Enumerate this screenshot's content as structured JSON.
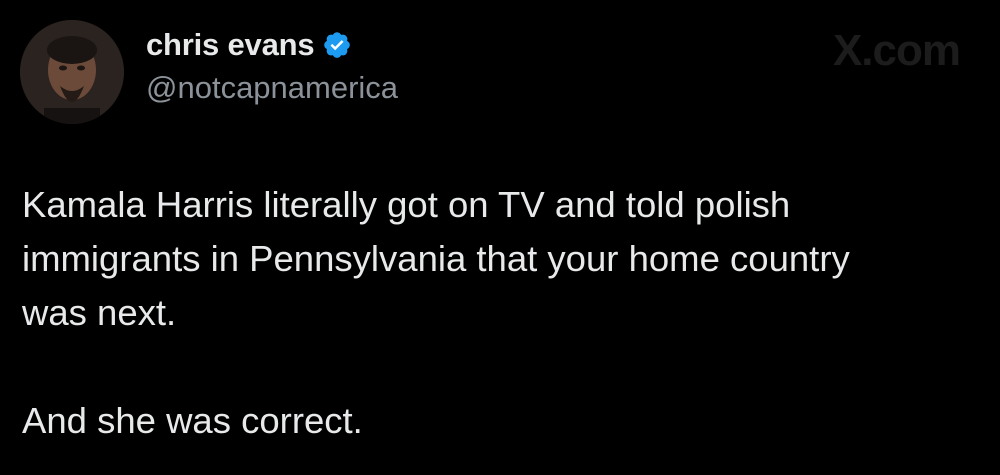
{
  "tweet": {
    "author": {
      "display_name": "chris evans",
      "handle": "@notcapnamerica",
      "verified": true,
      "avatar": "profile-photo"
    },
    "watermark": "X.com",
    "text": {
      "paragraph_1": "Kamala Harris literally got on TV and told polish\nimmigrants in Pennsylvania that your home country\nwas next.",
      "paragraph_2": "And she was correct."
    }
  },
  "colors": {
    "background": "#000000",
    "primary_text": "#e7e9ea",
    "secondary_text": "#8b9299",
    "verified_badge": "#1d9bf0"
  },
  "icons": {
    "verified": "verified-badge-icon"
  }
}
